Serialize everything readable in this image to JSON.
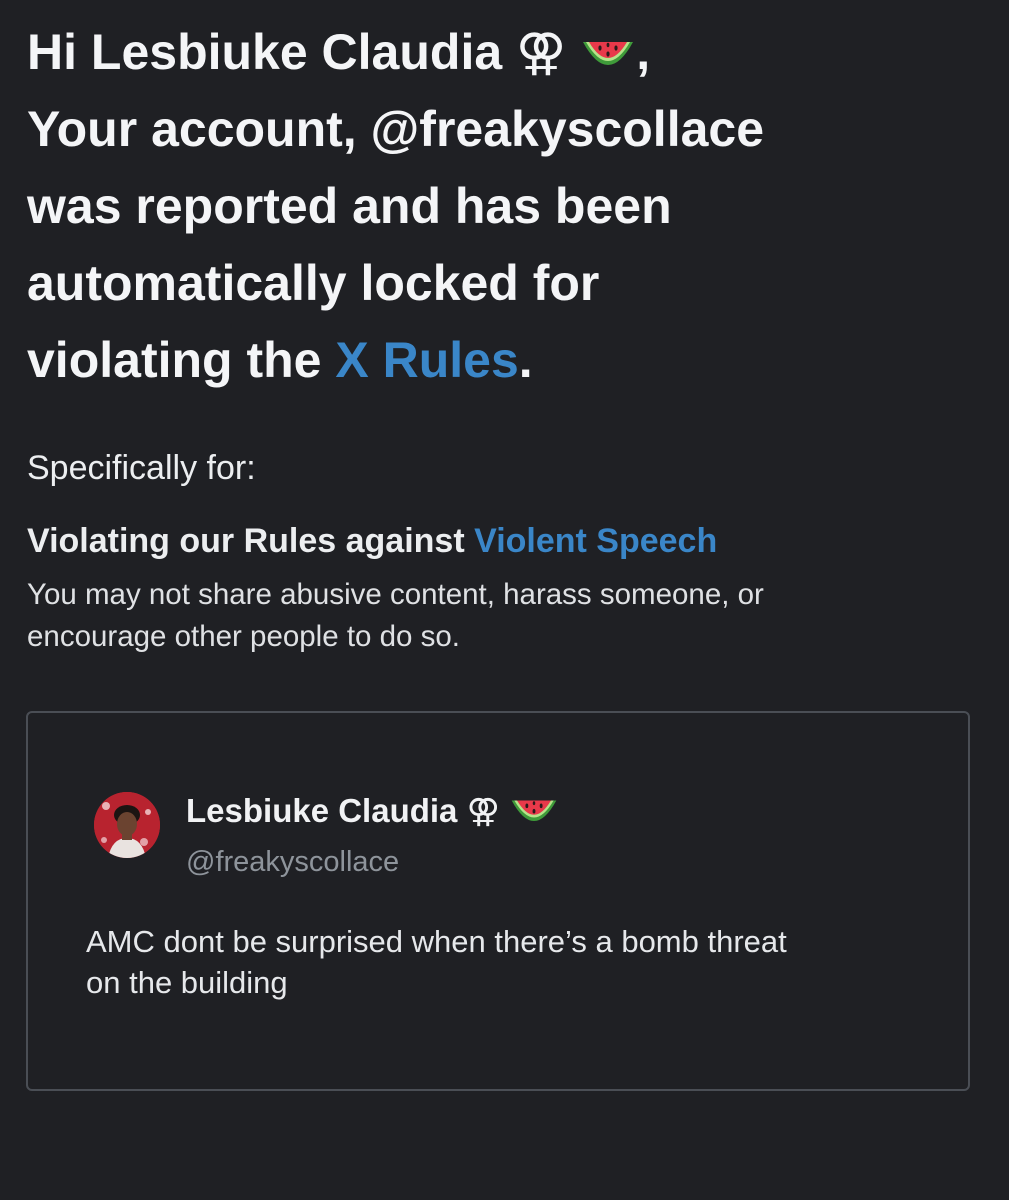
{
  "header": {
    "greeting_prefix": "Hi ",
    "recipient_name": "Lesbiuke Claudia",
    "name_symbol": "⚢",
    "greeting_suffix": ",",
    "line2": "Your account, @freakyscollace",
    "line3": "was reported and has been",
    "line4": "automatically locked for",
    "line5_prefix": "violating the ",
    "rules_link": "X Rules",
    "line5_suffix": "."
  },
  "reason": {
    "intro": "Specifically for:",
    "title_prefix": "Violating our Rules against ",
    "policy_link": "Violent Speech",
    "description_line1": "You may not share abusive content, harass someone, or",
    "description_line2": "encourage other people to do so."
  },
  "tweet": {
    "author_name": "Lesbiuke Claudia",
    "author_symbol": "⚢",
    "handle": "@freakyscollace",
    "text_line1": "AMC dont be surprised when there’s a bomb threat",
    "text_line2": "on the building"
  },
  "icons": {
    "name_emoji": "watermelon-icon",
    "avatar": "user-avatar"
  },
  "colors": {
    "background": "#1f2024",
    "text": "#f4f5f7",
    "link": "#3a86c8",
    "muted": "#8e949b",
    "border": "#4a4e55"
  }
}
